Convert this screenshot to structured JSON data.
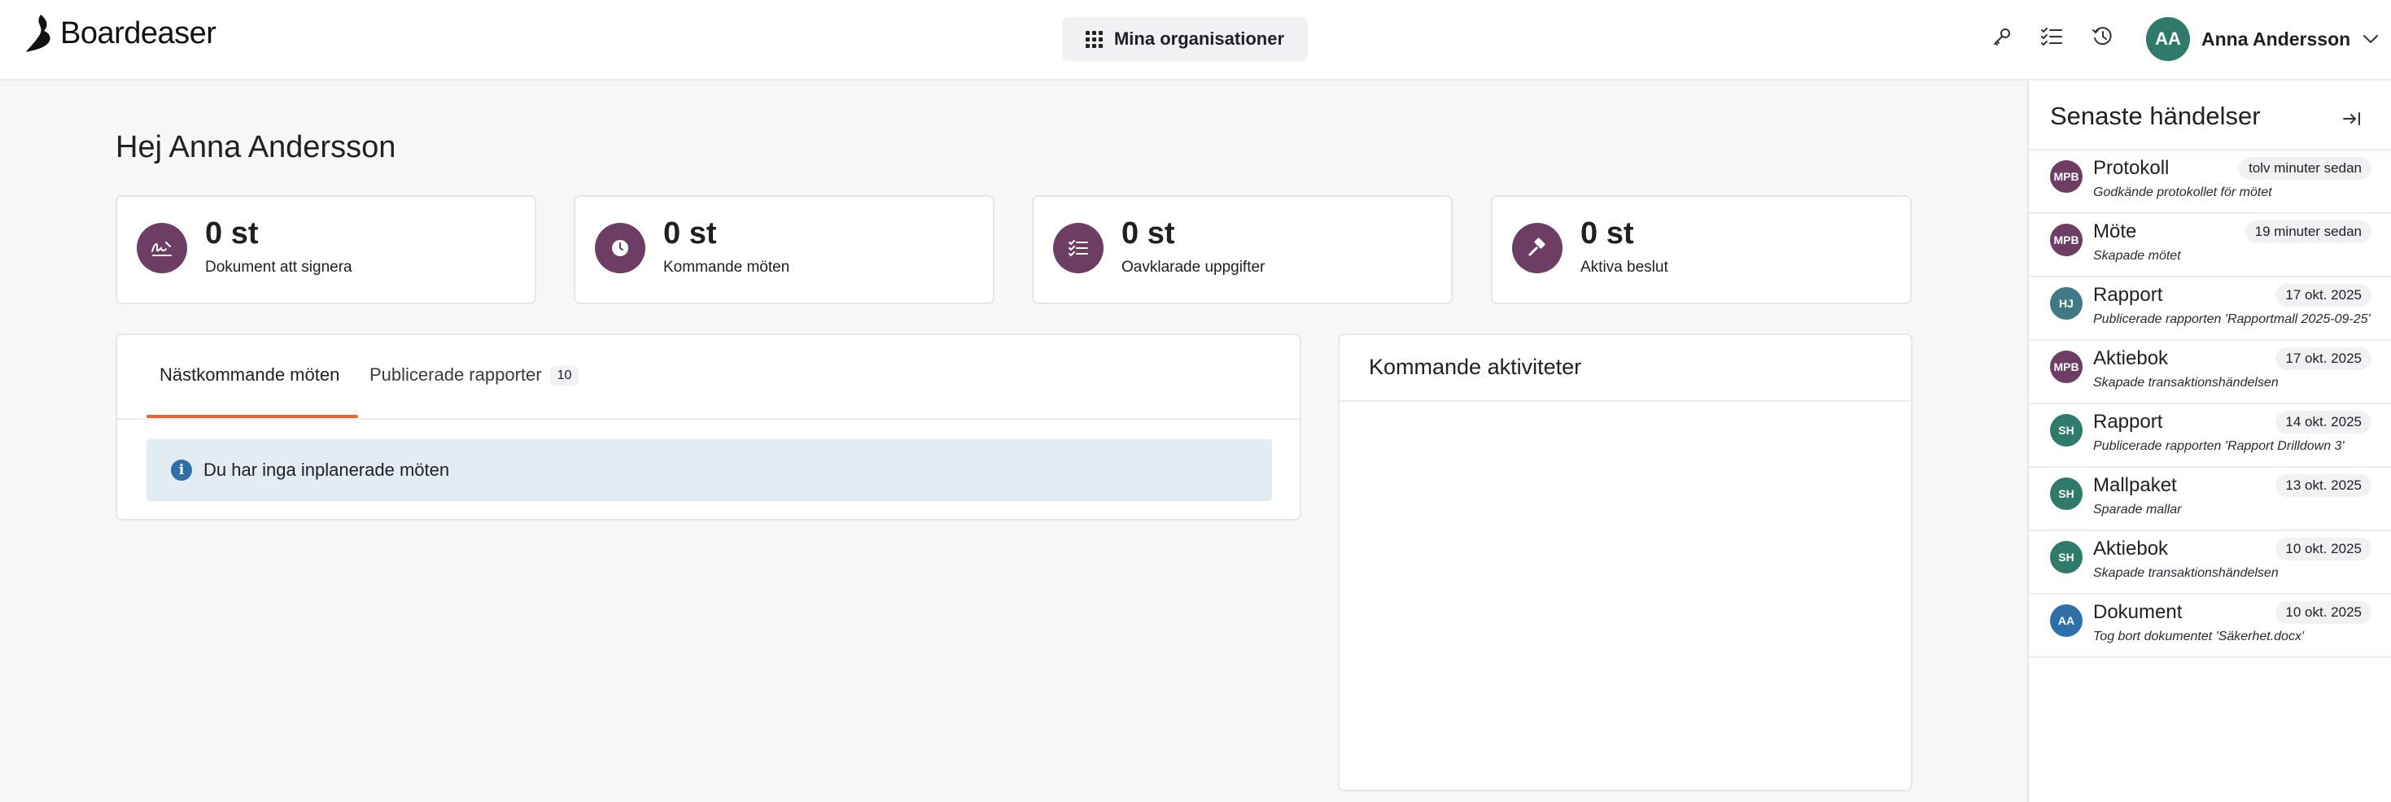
{
  "header": {
    "logo_text": "Boardeaser",
    "org_button_label": "Mina organisationer",
    "user": {
      "initials": "AA",
      "name": "Anna Andersson",
      "avatar_color": "#2f7a6a"
    },
    "icons": [
      "key-icon",
      "checklist-icon",
      "history-icon",
      "chevron-down-icon"
    ]
  },
  "main": {
    "greeting": "Hej Anna Andersson",
    "stats": [
      {
        "value": "0 st",
        "label": "Dokument att signera",
        "icon": "signature-icon"
      },
      {
        "value": "0 st",
        "label": "Kommande möten",
        "icon": "clock-icon"
      },
      {
        "value": "0 st",
        "label": "Oavklarade uppgifter",
        "icon": "checklist-icon"
      },
      {
        "value": "0 st",
        "label": "Aktiva beslut",
        "icon": "gavel-icon"
      }
    ],
    "tabs": [
      {
        "label": "Nästkommande möten",
        "active": true
      },
      {
        "label": "Publicerade rapporter",
        "count": "10",
        "active": false
      }
    ],
    "info_message": "Du har inga inplanerade möten",
    "activities_title": "Kommande aktiviteter"
  },
  "panel": {
    "title": "Senaste händelser",
    "events": [
      {
        "initials": "MPB",
        "color": "#6d3d63",
        "title": "Protokoll",
        "time": "tolv minuter sedan",
        "desc": "Godkände protokollet för mötet"
      },
      {
        "initials": "MPB",
        "color": "#6d3d63",
        "title": "Möte",
        "time": "19 minuter sedan",
        "desc": "Skapade mötet"
      },
      {
        "initials": "HJ",
        "color": "#3f7a86",
        "title": "Rapport",
        "time": "17 okt. 2025",
        "desc": "Publicerade rapporten 'Rapportmall 2025-09-25'"
      },
      {
        "initials": "MPB",
        "color": "#6d3d63",
        "title": "Aktiebok",
        "time": "17 okt. 2025",
        "desc": "Skapade transaktionshändelsen"
      },
      {
        "initials": "SH",
        "color": "#2f7a6a",
        "title": "Rapport",
        "time": "14 okt. 2025",
        "desc": "Publicerade rapporten 'Rapport Drilldown 3'"
      },
      {
        "initials": "SH",
        "color": "#2f7a6a",
        "title": "Mallpaket",
        "time": "13 okt. 2025",
        "desc": "Sparade mallar"
      },
      {
        "initials": "SH",
        "color": "#2f7a6a",
        "title": "Aktiebok",
        "time": "10 okt. 2025",
        "desc": "Skapade transaktionshändelsen"
      },
      {
        "initials": "AA",
        "color": "#2f6fa8",
        "title": "Dokument",
        "time": "10 okt. 2025",
        "desc": "Tog bort dokumentet 'Säkerhet.docx'"
      }
    ]
  },
  "colors": {
    "accent": "#e0693a",
    "stat_icon_bg": "#6d3d63",
    "info_bg": "#e3ecf2",
    "info_icon": "#2f6fa8"
  }
}
